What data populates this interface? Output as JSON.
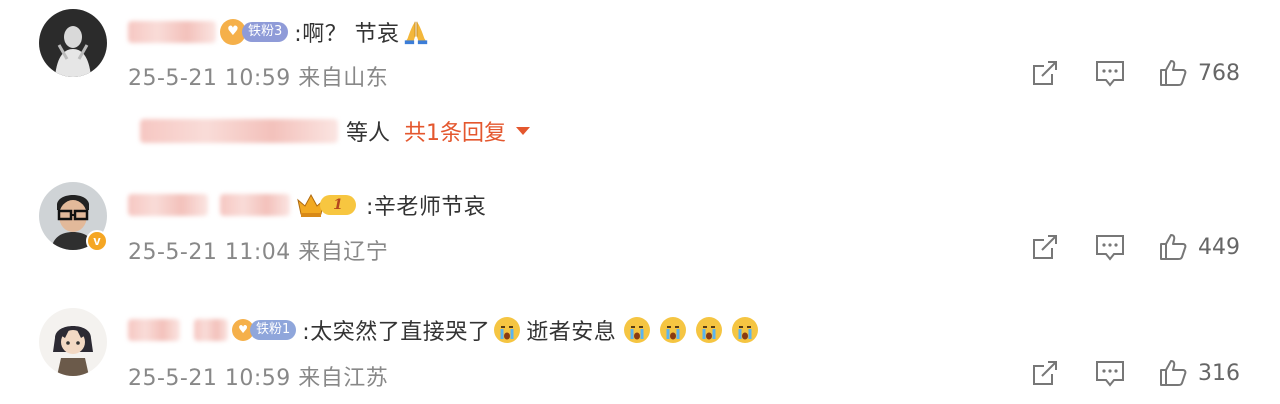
{
  "comments": [
    {
      "fan_badge": "铁粉3",
      "text": ":啊？ 节哀",
      "time": "25-5-21 10:59",
      "location": "来自山东",
      "likes": "768",
      "reply_summary": {
        "label": "等人",
        "link": "共1条回复"
      }
    },
    {
      "crown_level": "1",
      "verified_mark": "v",
      "text": ":辛老师节哀",
      "time": "25-5-21 11:04",
      "location": "来自辽宁",
      "likes": "449"
    },
    {
      "fan_badge": "铁粉1",
      "text": ":太突然了直接哭了",
      "text2": "逝者安息",
      "time": "25-5-21 10:59",
      "location": "来自江苏",
      "likes": "316"
    }
  ],
  "colors": {
    "accent": "#e4572e",
    "meta": "#888888",
    "text": "#333333"
  },
  "icons": [
    "share-icon",
    "comment-icon",
    "like-icon",
    "pray-emoji",
    "crying-emoji",
    "crown-icon"
  ]
}
